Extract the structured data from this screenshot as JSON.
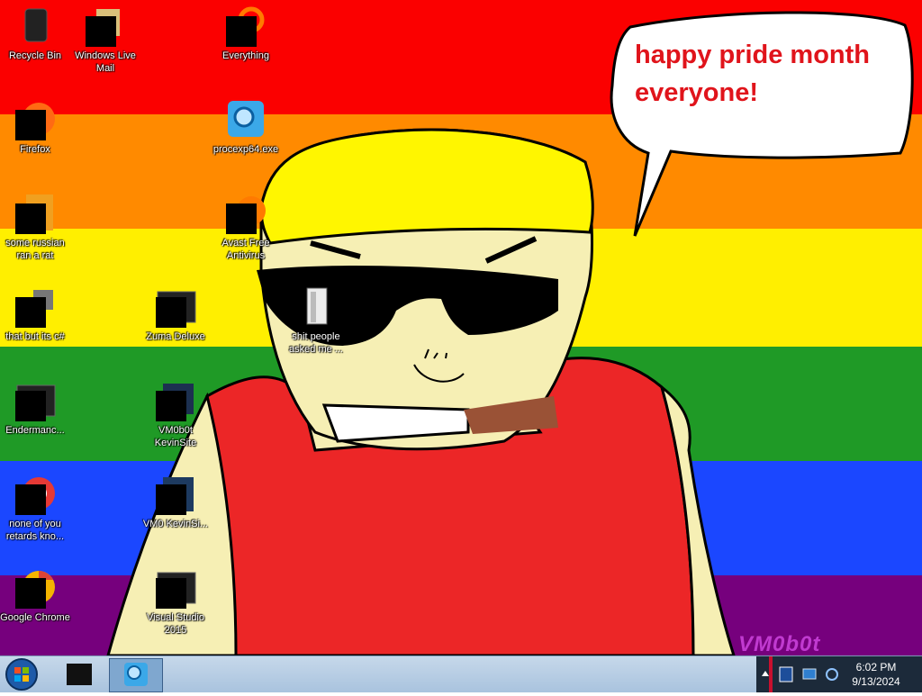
{
  "wallpaper": {
    "stripe_colors": [
      "#fb0000",
      "#ff8a00",
      "#ffef00",
      "#1f9a26",
      "#1b47ff",
      "#76007d"
    ],
    "speech_bubble_text": "happy pride month everyone!",
    "watermark": "VM0b0t"
  },
  "desktop_icons": [
    {
      "label": "Recycle Bin",
      "icon": "recycle-bin-icon"
    },
    {
      "label": "Windows Live Mail",
      "icon": "mail-icon"
    },
    {
      "label": "Everything",
      "icon": "search-app-icon"
    },
    {
      "label": "Firefox",
      "icon": "firefox-icon"
    },
    {
      "label": "procexp64.exe",
      "icon": "magnifier-icon"
    },
    {
      "label": "some russian ran a rat",
      "icon": "file-icon"
    },
    {
      "label": "Avast Free Antivirus",
      "icon": "avast-icon"
    },
    {
      "label": "that but its c#",
      "icon": "stack-icon"
    },
    {
      "label": "Zuma Deluxe",
      "icon": "app-window-icon"
    },
    {
      "label": "shit people asked me ...",
      "icon": "folder-icon"
    },
    {
      "label": "Endermanc...",
      "icon": "app-window-icon"
    },
    {
      "label": "VM0b0t KevinSite",
      "icon": "app-window-icon"
    },
    {
      "label": "none of you retards kno...",
      "icon": "browser-icon"
    },
    {
      "label": "VM0 KevinSi...",
      "icon": "app-window-icon"
    },
    {
      "label": "Google Chrome",
      "icon": "chrome-icon"
    },
    {
      "label": "Visual Studio 2015",
      "icon": "app-window-icon"
    }
  ],
  "taskbar": {
    "start_icon": "windows-orb-icon",
    "pinned": [
      "app-window-icon",
      "magnifier-icon"
    ],
    "tray_icons": [
      "show-hidden-icon",
      "shield-icon",
      "network-icon",
      "volume-icon"
    ],
    "time": "6:02 PM",
    "date": "9/13/2024"
  }
}
